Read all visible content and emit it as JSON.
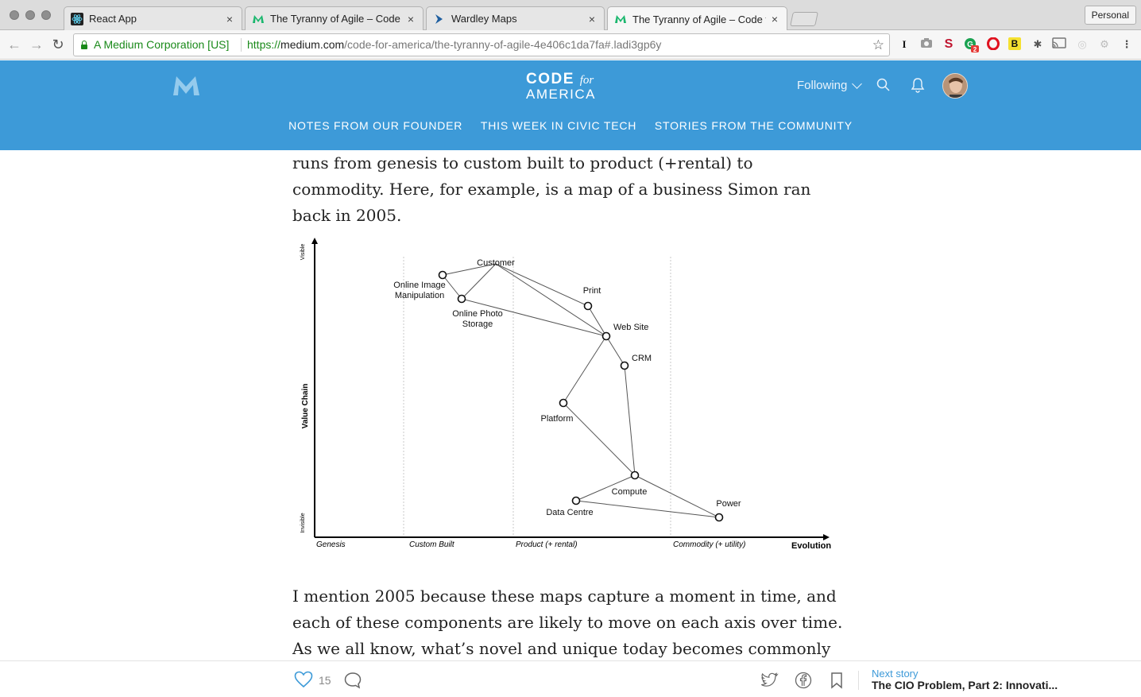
{
  "browser": {
    "tabs": [
      {
        "title": "React App",
        "icon": "react-icon"
      },
      {
        "title": "The Tyranny of Agile – Code fo",
        "icon": "medium-icon"
      },
      {
        "title": "Wardley Maps",
        "icon": "wardley-icon"
      },
      {
        "title": "The Tyranny of Agile – Code fo",
        "icon": "medium-icon",
        "active": true
      }
    ],
    "profile": "Personal",
    "security_label": "A Medium Corporation [US]",
    "url_scheme": "https://",
    "url_host": "medium.com",
    "url_path": "/code-for-america/the-tyranny-of-agile-4e406c1da7fa#.ladi3gp6y",
    "extension_badge": "2"
  },
  "header": {
    "logo_line1": "CODE",
    "logo_for": "for",
    "logo_line2": "AMERICA",
    "following": "Following",
    "nav": [
      "NOTES FROM OUR FOUNDER",
      "THIS WEEK IN CIVIC TECH",
      "STORIES FROM THE COMMUNITY"
    ],
    "brand_color": "#3d9ad8"
  },
  "article": {
    "para1": "runs from genesis to custom built to product (+rental) to commodity. Here, for example, is a map of a business Simon ran back in 2005.",
    "para2": "I mention 2005 because these maps capture a moment in time, and each of these components are likely to move on each axis over time. As we all know, what’s novel and unique today becomes commonly available and then"
  },
  "chart_data": {
    "type": "diagram",
    "y_axis": {
      "label": "Value Chain",
      "top": "Visible",
      "bottom": "Invisible"
    },
    "x_axis": {
      "label": "Evolution",
      "stages": [
        "Genesis",
        "Custom Built",
        "Product (+ rental)",
        "Commodity (+ utility)"
      ]
    },
    "nodes": [
      {
        "id": "customer",
        "label": "Customer"
      },
      {
        "id": "oim",
        "label": "Online Image Manipulation"
      },
      {
        "id": "ops",
        "label": "Online Photo Storage"
      },
      {
        "id": "print",
        "label": "Print"
      },
      {
        "id": "web",
        "label": "Web Site"
      },
      {
        "id": "crm",
        "label": "CRM"
      },
      {
        "id": "platform",
        "label": "Platform"
      },
      {
        "id": "compute",
        "label": "Compute"
      },
      {
        "id": "dc",
        "label": "Data Centre"
      },
      {
        "id": "power",
        "label": "Power"
      }
    ],
    "edges": [
      [
        "customer",
        "oim"
      ],
      [
        "customer",
        "ops"
      ],
      [
        "customer",
        "print"
      ],
      [
        "customer",
        "web"
      ],
      [
        "oim",
        "ops"
      ],
      [
        "ops",
        "web"
      ],
      [
        "print",
        "web"
      ],
      [
        "web",
        "crm"
      ],
      [
        "web",
        "platform"
      ],
      [
        "crm",
        "compute"
      ],
      [
        "platform",
        "compute"
      ],
      [
        "compute",
        "dc"
      ],
      [
        "compute",
        "power"
      ],
      [
        "dc",
        "power"
      ]
    ]
  },
  "actionbar": {
    "likes": "15",
    "next_label": "Next story",
    "next_title": "The CIO Problem, Part 2: Innovati..."
  }
}
